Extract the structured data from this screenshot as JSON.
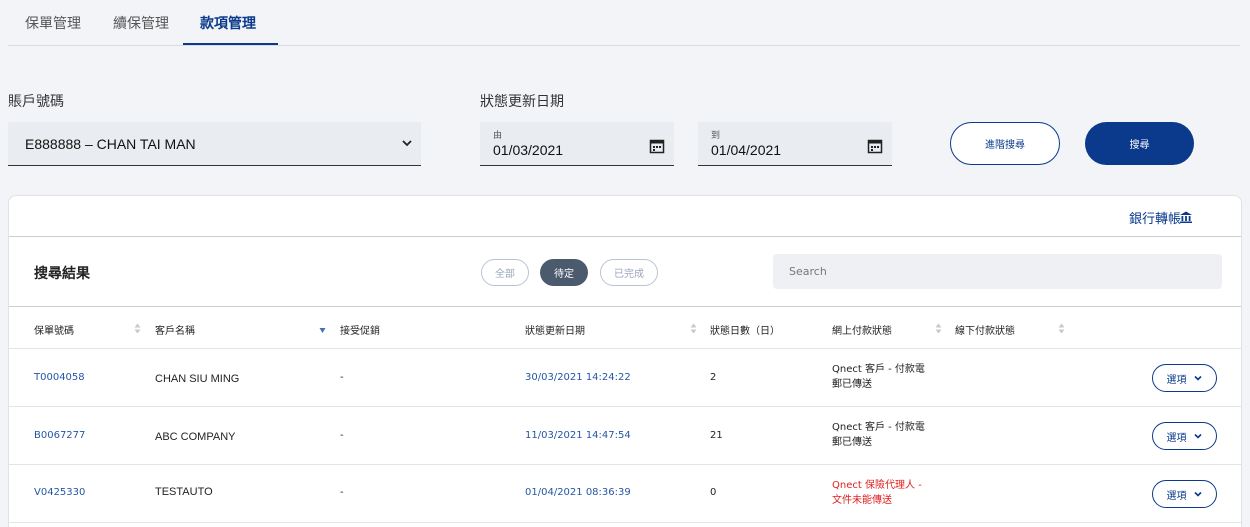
{
  "tabs": [
    {
      "label": "保單管理"
    },
    {
      "label": "續保管理"
    },
    {
      "label": "款項管理"
    }
  ],
  "filters": {
    "account_label": "賬戶號碼",
    "account_value": "E888888 – CHAN TAI MAN",
    "date_label": "狀態更新日期",
    "from_label": "由",
    "from_value": "01/03/2021",
    "to_label": "到",
    "to_value": "01/04/2021",
    "advanced_button": "進階搜尋",
    "search_button": "搜尋"
  },
  "card": {
    "bank_link": "銀行轉帳",
    "results_title": "搜尋結果",
    "pills": {
      "all": "全部",
      "pending": "待定",
      "done": "已完成"
    },
    "search_placeholder": "Search"
  },
  "table": {
    "headers": [
      "保單號碼",
      "客戶名稱",
      "接受促銷",
      "狀態更新日期",
      "狀態日數（日）",
      "網上付款狀態",
      "線下付款狀態"
    ],
    "rows": [
      {
        "policy": "T0004058",
        "customer": "CHAN SIU MING",
        "promo": "-",
        "updated": "30/03/2021 14:24:22",
        "days": "2",
        "online_1": "Qnect 客戶 - 付款電",
        "online_2": "郵已傳送",
        "options": "選項"
      },
      {
        "policy": "B0067277",
        "customer": "ABC COMPANY",
        "promo": "-",
        "updated": "11/03/2021 14:47:54",
        "days": "21",
        "online_1": "Qnect 客戶 - 付款電",
        "online_2": "郵已傳送",
        "options": "選項"
      },
      {
        "policy": "V0425330",
        "customer": "TESTAUTO",
        "promo": "-",
        "updated": "01/04/2021 08:36:39",
        "days": "0",
        "online_1": "Qnect 保險代理人 -",
        "online_2": "文件未能傳送",
        "options": "選項"
      }
    ]
  },
  "colors": {
    "accent": "#0b3a8c",
    "link": "#2556a6",
    "error": "#e02020"
  }
}
